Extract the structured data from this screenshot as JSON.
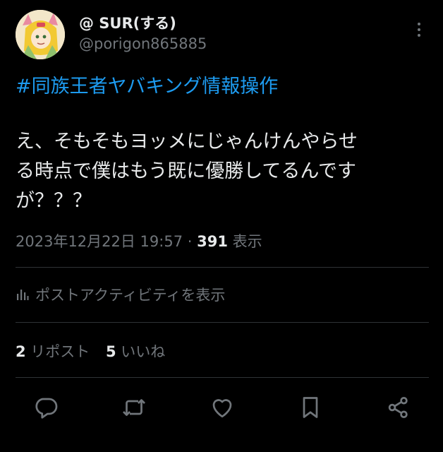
{
  "author": {
    "display_name": "@ SUR(する)",
    "handle": "@porigon865885"
  },
  "post": {
    "hashtag": "#同族王者ヤバキング情報操作",
    "lines": [
      "え、そもそもヨッメにじゃんけんやらせ",
      "る時点で僕はもう既に優勝してるんです",
      "が？？？"
    ]
  },
  "meta": {
    "timestamp": "2023年12月22日 19:57",
    "separator": " · ",
    "views_count": "391",
    "views_label": " 表示"
  },
  "activity": {
    "label": "ポストアクティビティを表示",
    "icon": "bar-chart-icon"
  },
  "stats": {
    "reposts_count": "2",
    "reposts_label": " リポスト",
    "likes_count": "5",
    "likes_label": " いいね"
  },
  "actions": {
    "icons": [
      "reply-icon",
      "repost-icon",
      "like-icon",
      "bookmark-icon",
      "share-icon"
    ]
  },
  "colors": {
    "background": "#000000",
    "text": "#e7e9ea",
    "muted": "#71767b",
    "link": "#1d9bf0",
    "divider": "#2f3336"
  }
}
